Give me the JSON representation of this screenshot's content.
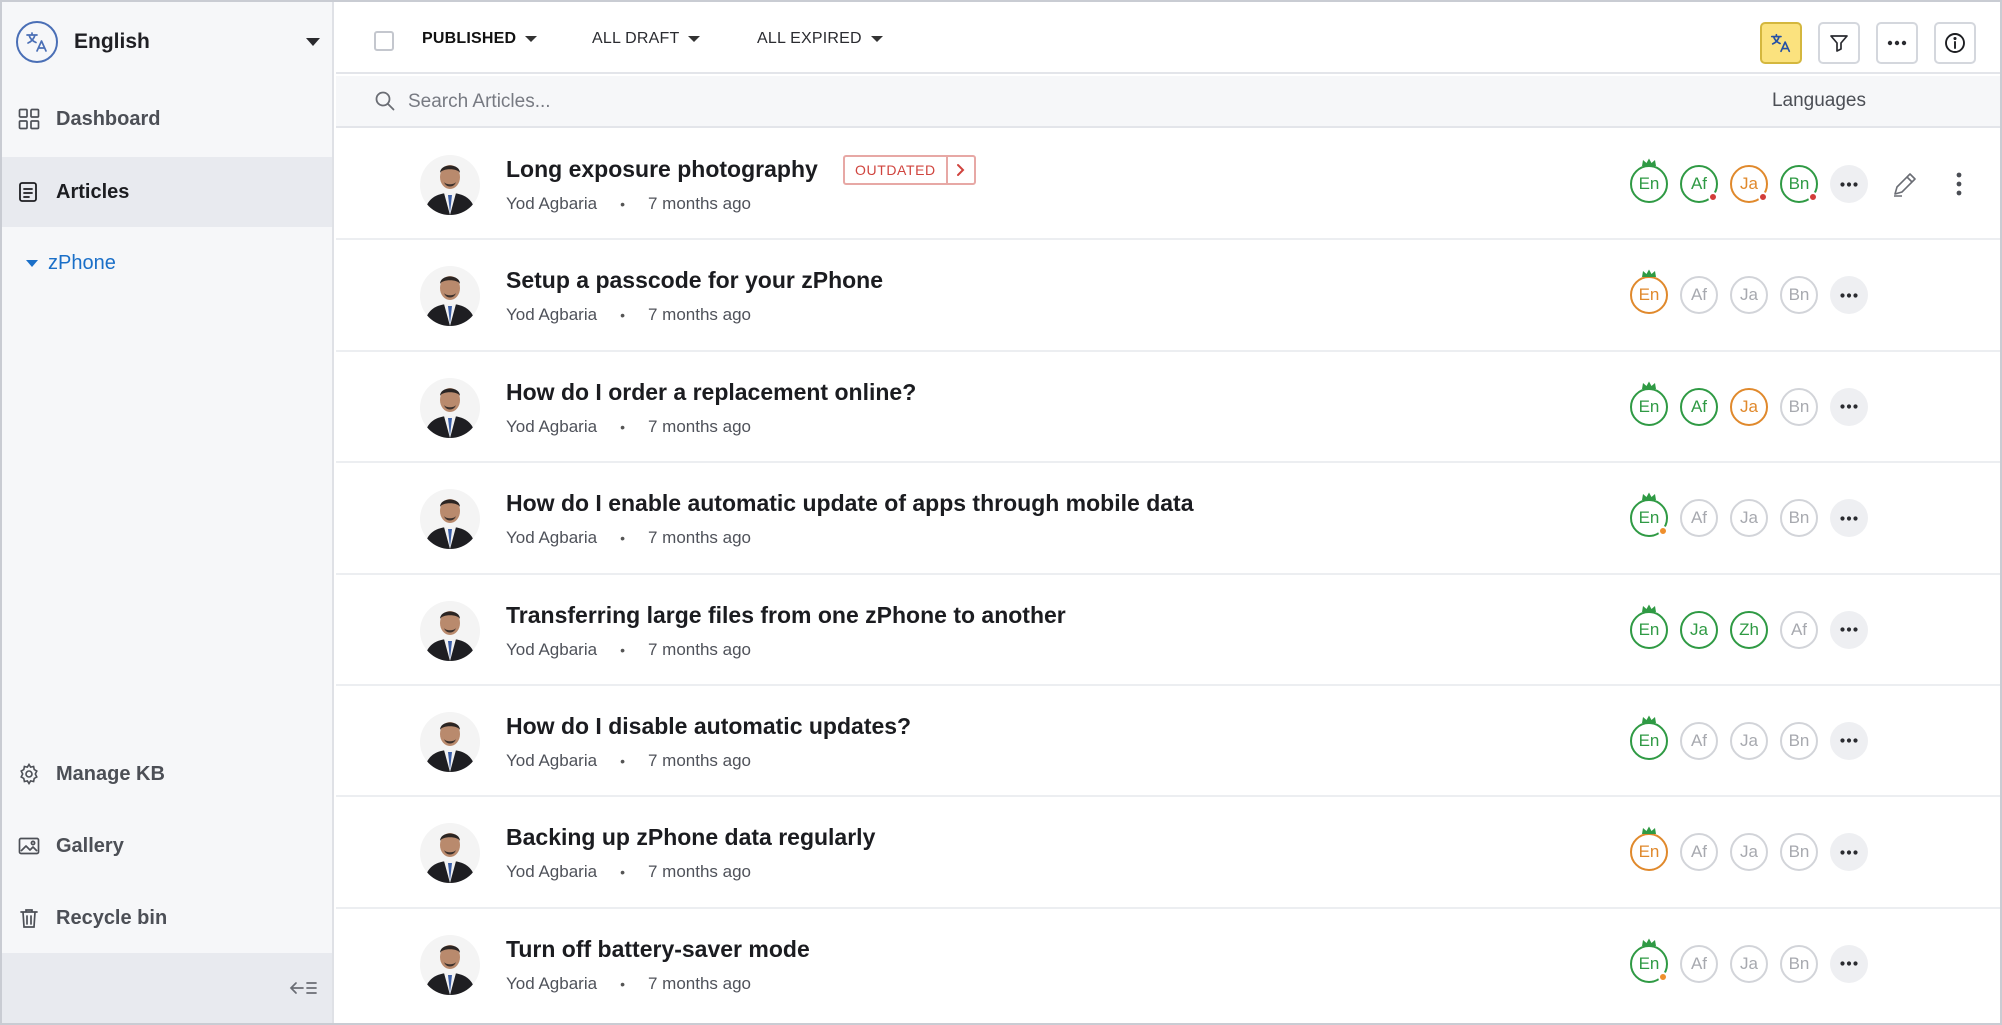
{
  "sidebar": {
    "language": "English",
    "nav": [
      {
        "label": "Dashboard",
        "icon": "dashboard-grid-icon"
      },
      {
        "label": "Articles",
        "icon": "articles-icon"
      }
    ],
    "category": "zPhone",
    "bottom_nav": [
      {
        "label": "Manage KB",
        "icon": "gear-icon"
      },
      {
        "label": "Gallery",
        "icon": "image-icon"
      },
      {
        "label": "Recycle bin",
        "icon": "trash-icon"
      }
    ]
  },
  "toolbar": {
    "tabs": [
      {
        "label": "PUBLISHED"
      },
      {
        "label": "ALL DRAFT"
      },
      {
        "label": "ALL EXPIRED"
      }
    ]
  },
  "search": {
    "placeholder": "Search Articles...",
    "languages_label": "Languages"
  },
  "articles": [
    {
      "title": "Long exposure photography",
      "author": "Yod Agbaria",
      "time": "7 months ago",
      "badge": "OUTDATED"
    },
    {
      "title": "Setup a passcode for your zPhone",
      "author": "Yod Agbaria",
      "time": "7 months ago"
    },
    {
      "title": "How do I order a replacement online?",
      "author": "Yod Agbaria",
      "time": "7 months ago"
    },
    {
      "title": "How do I enable automatic update of apps through mobile data",
      "author": "Yod Agbaria",
      "time": "7 months ago"
    },
    {
      "title": "Transferring large files from one zPhone to another",
      "author": "Yod Agbaria",
      "time": "7 months ago"
    },
    {
      "title": "How do I disable automatic updates?",
      "author": "Yod Agbaria",
      "time": "7 months ago"
    },
    {
      "title": "Backing up zPhone data regularly",
      "author": "Yod Agbaria",
      "time": "7 months ago"
    },
    {
      "title": "Turn off battery-saver mode",
      "author": "Yod Agbaria",
      "time": "7 months ago"
    }
  ],
  "lang_rows": [
    [
      {
        "code": "En",
        "s": "green",
        "crown": true
      },
      {
        "code": "Af",
        "s": "green",
        "dot": "red"
      },
      {
        "code": "Ja",
        "s": "orange",
        "dot": "red"
      },
      {
        "code": "Bn",
        "s": "green",
        "dot": "red"
      }
    ],
    [
      {
        "code": "En",
        "s": "orange",
        "crown": true
      },
      {
        "code": "Af",
        "s": "grey"
      },
      {
        "code": "Ja",
        "s": "grey"
      },
      {
        "code": "Bn",
        "s": "grey"
      }
    ],
    [
      {
        "code": "En",
        "s": "green",
        "crown": true
      },
      {
        "code": "Af",
        "s": "green"
      },
      {
        "code": "Ja",
        "s": "orange"
      },
      {
        "code": "Bn",
        "s": "grey"
      }
    ],
    [
      {
        "code": "En",
        "s": "green",
        "crown": true,
        "dot": "orange"
      },
      {
        "code": "Af",
        "s": "grey"
      },
      {
        "code": "Ja",
        "s": "grey"
      },
      {
        "code": "Bn",
        "s": "grey"
      }
    ],
    [
      {
        "code": "En",
        "s": "green",
        "crown": true
      },
      {
        "code": "Ja",
        "s": "green"
      },
      {
        "code": "Zh",
        "s": "green"
      },
      {
        "code": "Af",
        "s": "grey"
      }
    ],
    [
      {
        "code": "En",
        "s": "green",
        "crown": true
      },
      {
        "code": "Af",
        "s": "grey"
      },
      {
        "code": "Ja",
        "s": "grey"
      },
      {
        "code": "Bn",
        "s": "grey"
      }
    ],
    [
      {
        "code": "En",
        "s": "orange",
        "crown": true
      },
      {
        "code": "Af",
        "s": "grey"
      },
      {
        "code": "Ja",
        "s": "grey"
      },
      {
        "code": "Bn",
        "s": "grey"
      }
    ],
    [
      {
        "code": "En",
        "s": "green",
        "crown": true,
        "dot": "orange"
      },
      {
        "code": "Af",
        "s": "grey"
      },
      {
        "code": "Ja",
        "s": "grey"
      },
      {
        "code": "Bn",
        "s": "grey"
      }
    ]
  ],
  "colors": {
    "accent": "#1a6fc8",
    "published_green": "#2f9a44",
    "outdated_orange": "#e0892c",
    "outdated_red": "#d0443e",
    "translate_button": "#fbe27e"
  }
}
